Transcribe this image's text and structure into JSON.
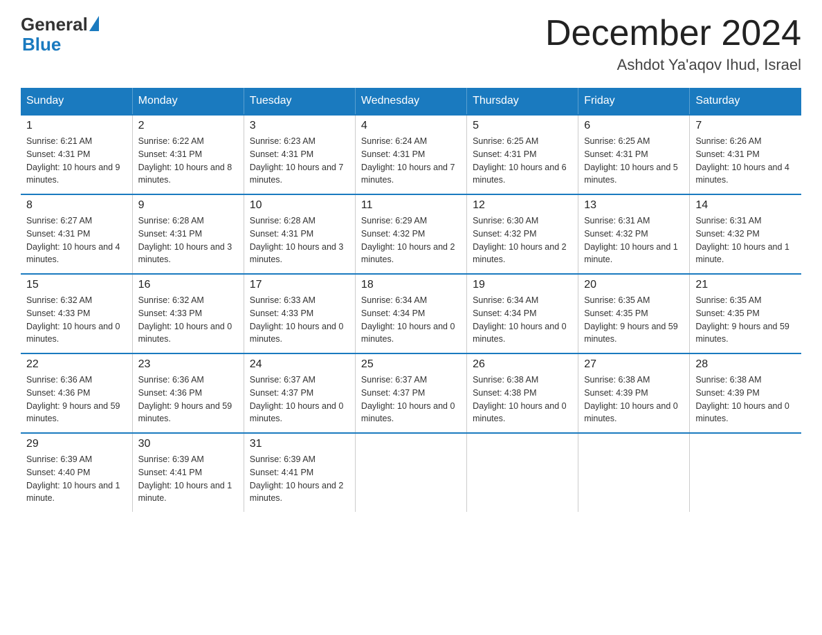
{
  "logo": {
    "general": "General",
    "blue": "Blue"
  },
  "title": {
    "month_year": "December 2024",
    "location": "Ashdot Ya'aqov Ihud, Israel"
  },
  "weekdays": [
    "Sunday",
    "Monday",
    "Tuesday",
    "Wednesday",
    "Thursday",
    "Friday",
    "Saturday"
  ],
  "weeks": [
    [
      {
        "day": "1",
        "sunrise": "6:21 AM",
        "sunset": "4:31 PM",
        "daylight": "10 hours and 9 minutes."
      },
      {
        "day": "2",
        "sunrise": "6:22 AM",
        "sunset": "4:31 PM",
        "daylight": "10 hours and 8 minutes."
      },
      {
        "day": "3",
        "sunrise": "6:23 AM",
        "sunset": "4:31 PM",
        "daylight": "10 hours and 7 minutes."
      },
      {
        "day": "4",
        "sunrise": "6:24 AM",
        "sunset": "4:31 PM",
        "daylight": "10 hours and 7 minutes."
      },
      {
        "day": "5",
        "sunrise": "6:25 AM",
        "sunset": "4:31 PM",
        "daylight": "10 hours and 6 minutes."
      },
      {
        "day": "6",
        "sunrise": "6:25 AM",
        "sunset": "4:31 PM",
        "daylight": "10 hours and 5 minutes."
      },
      {
        "day": "7",
        "sunrise": "6:26 AM",
        "sunset": "4:31 PM",
        "daylight": "10 hours and 4 minutes."
      }
    ],
    [
      {
        "day": "8",
        "sunrise": "6:27 AM",
        "sunset": "4:31 PM",
        "daylight": "10 hours and 4 minutes."
      },
      {
        "day": "9",
        "sunrise": "6:28 AM",
        "sunset": "4:31 PM",
        "daylight": "10 hours and 3 minutes."
      },
      {
        "day": "10",
        "sunrise": "6:28 AM",
        "sunset": "4:31 PM",
        "daylight": "10 hours and 3 minutes."
      },
      {
        "day": "11",
        "sunrise": "6:29 AM",
        "sunset": "4:32 PM",
        "daylight": "10 hours and 2 minutes."
      },
      {
        "day": "12",
        "sunrise": "6:30 AM",
        "sunset": "4:32 PM",
        "daylight": "10 hours and 2 minutes."
      },
      {
        "day": "13",
        "sunrise": "6:31 AM",
        "sunset": "4:32 PM",
        "daylight": "10 hours and 1 minute."
      },
      {
        "day": "14",
        "sunrise": "6:31 AM",
        "sunset": "4:32 PM",
        "daylight": "10 hours and 1 minute."
      }
    ],
    [
      {
        "day": "15",
        "sunrise": "6:32 AM",
        "sunset": "4:33 PM",
        "daylight": "10 hours and 0 minutes."
      },
      {
        "day": "16",
        "sunrise": "6:32 AM",
        "sunset": "4:33 PM",
        "daylight": "10 hours and 0 minutes."
      },
      {
        "day": "17",
        "sunrise": "6:33 AM",
        "sunset": "4:33 PM",
        "daylight": "10 hours and 0 minutes."
      },
      {
        "day": "18",
        "sunrise": "6:34 AM",
        "sunset": "4:34 PM",
        "daylight": "10 hours and 0 minutes."
      },
      {
        "day": "19",
        "sunrise": "6:34 AM",
        "sunset": "4:34 PM",
        "daylight": "10 hours and 0 minutes."
      },
      {
        "day": "20",
        "sunrise": "6:35 AM",
        "sunset": "4:35 PM",
        "daylight": "9 hours and 59 minutes."
      },
      {
        "day": "21",
        "sunrise": "6:35 AM",
        "sunset": "4:35 PM",
        "daylight": "9 hours and 59 minutes."
      }
    ],
    [
      {
        "day": "22",
        "sunrise": "6:36 AM",
        "sunset": "4:36 PM",
        "daylight": "9 hours and 59 minutes."
      },
      {
        "day": "23",
        "sunrise": "6:36 AM",
        "sunset": "4:36 PM",
        "daylight": "9 hours and 59 minutes."
      },
      {
        "day": "24",
        "sunrise": "6:37 AM",
        "sunset": "4:37 PM",
        "daylight": "10 hours and 0 minutes."
      },
      {
        "day": "25",
        "sunrise": "6:37 AM",
        "sunset": "4:37 PM",
        "daylight": "10 hours and 0 minutes."
      },
      {
        "day": "26",
        "sunrise": "6:38 AM",
        "sunset": "4:38 PM",
        "daylight": "10 hours and 0 minutes."
      },
      {
        "day": "27",
        "sunrise": "6:38 AM",
        "sunset": "4:39 PM",
        "daylight": "10 hours and 0 minutes."
      },
      {
        "day": "28",
        "sunrise": "6:38 AM",
        "sunset": "4:39 PM",
        "daylight": "10 hours and 0 minutes."
      }
    ],
    [
      {
        "day": "29",
        "sunrise": "6:39 AM",
        "sunset": "4:40 PM",
        "daylight": "10 hours and 1 minute."
      },
      {
        "day": "30",
        "sunrise": "6:39 AM",
        "sunset": "4:41 PM",
        "daylight": "10 hours and 1 minute."
      },
      {
        "day": "31",
        "sunrise": "6:39 AM",
        "sunset": "4:41 PM",
        "daylight": "10 hours and 2 minutes."
      },
      null,
      null,
      null,
      null
    ]
  ],
  "labels": {
    "sunrise": "Sunrise:",
    "sunset": "Sunset:",
    "daylight": "Daylight:"
  }
}
